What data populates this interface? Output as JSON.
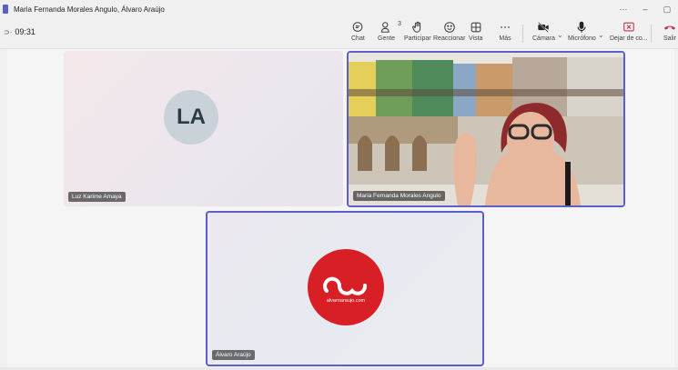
{
  "window": {
    "title": "Maria Fernanda Morales Angulo, Álvaro Araújo",
    "controls": [
      "···",
      "–",
      "▢"
    ]
  },
  "toolbar": {
    "timer": "09:31",
    "buttons": [
      {
        "id": "chat",
        "label": "Chat",
        "icon": "chat-icon"
      },
      {
        "id": "people",
        "label": "Gente",
        "icon": "people-icon",
        "badge": "3"
      },
      {
        "id": "raise",
        "label": "Participar",
        "icon": "raise-hand-icon"
      },
      {
        "id": "react",
        "label": "Reaccionar",
        "icon": "emoji-icon"
      },
      {
        "id": "view",
        "label": "Vista",
        "icon": "view-grid-icon"
      },
      {
        "id": "more",
        "label": "Más",
        "icon": "more-icon"
      },
      {
        "id": "camera",
        "label": "Cámara",
        "icon": "camera-off-icon"
      },
      {
        "id": "mic",
        "label": "Micrófono",
        "icon": "mic-icon"
      },
      {
        "id": "share",
        "label": "Dejar de co...",
        "icon": "stop-share-icon"
      },
      {
        "id": "leave",
        "label": "Salir",
        "icon": "phone-hangup-icon"
      }
    ]
  },
  "participants": [
    {
      "name": "Luz Karime Amaya",
      "initials": "LA"
    },
    {
      "name": "Maria Fernanda Morales Angulo"
    },
    {
      "name": "Álvaro Araújo",
      "logo_text": "alvaroaraujo.com"
    }
  ],
  "colors": {
    "accent": "#5b5fc7",
    "leave": "#c4314b",
    "logo": "#d81f26"
  }
}
